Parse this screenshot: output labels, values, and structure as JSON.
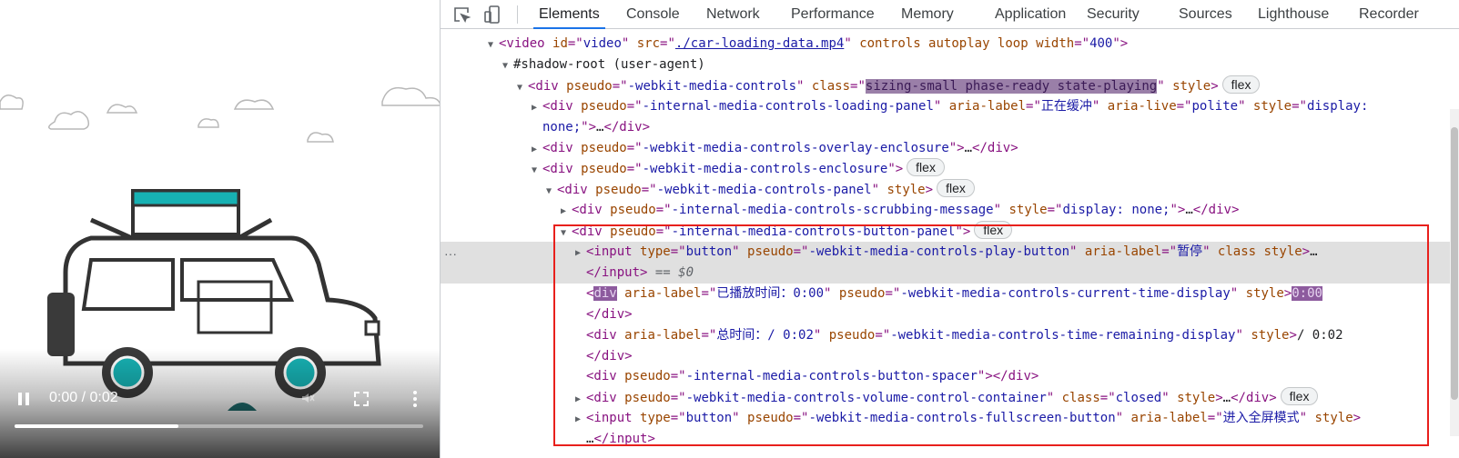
{
  "video": {
    "time_display": "0:00 / 0:02",
    "progress_fraction": 0.4,
    "icons": {
      "pause": "pause-icon",
      "mute": "mute-icon",
      "fullscreen": "fullscreen-icon",
      "menu": "more-vert-icon"
    }
  },
  "devtools": {
    "tabs": [
      "Elements",
      "Console",
      "Network",
      "Performance",
      "Memory",
      "Application",
      "Security",
      "Sources",
      "Lighthouse",
      "Recorder"
    ],
    "active_tab": "Elements",
    "tool_icons": [
      "inspect-element-icon",
      "device-toolbar-icon"
    ],
    "lines": [
      {
        "indent": 0,
        "arrow": "▼",
        "parts": [
          [
            "tag",
            "<video "
          ],
          [
            "an",
            "id"
          ],
          [
            "tag",
            "=\""
          ],
          [
            "av",
            "video"
          ],
          [
            "tag",
            "\" "
          ],
          [
            "an",
            "src"
          ],
          [
            "tag",
            "=\""
          ],
          [
            "link",
            "./car-loading-data.mp4"
          ],
          [
            "tag",
            "\" "
          ],
          [
            "an",
            "controls autoplay loop width"
          ],
          [
            "tag",
            "=\""
          ],
          [
            "av",
            "400"
          ],
          [
            "tag",
            "\">"
          ]
        ]
      },
      {
        "indent": 1,
        "arrow": "▼",
        "parts": [
          [
            "txt",
            "#shadow-root (user-agent)"
          ]
        ]
      },
      {
        "indent": 2,
        "arrow": "▼",
        "parts": [
          [
            "tag",
            "<div "
          ],
          [
            "an",
            "pseudo"
          ],
          [
            "tag",
            "=\""
          ],
          [
            "av",
            "-webkit-media-controls"
          ],
          [
            "tag",
            "\" "
          ],
          [
            "an",
            "class"
          ],
          [
            "tag",
            "=\""
          ],
          [
            "hl",
            "sizing-small phase-ready state-playing"
          ],
          [
            "tag",
            "\" "
          ],
          [
            "an",
            "style"
          ],
          [
            "tag",
            ">"
          ]
        ],
        "badge": "flex"
      },
      {
        "indent": 3,
        "arrow": "▶",
        "parts": [
          [
            "tag",
            "<div "
          ],
          [
            "an",
            "pseudo"
          ],
          [
            "tag",
            "=\""
          ],
          [
            "av",
            "-internal-media-controls-loading-panel"
          ],
          [
            "tag",
            "\" "
          ],
          [
            "an",
            "aria-label"
          ],
          [
            "tag",
            "=\""
          ],
          [
            "av",
            "正在缓冲"
          ],
          [
            "tag",
            "\" "
          ],
          [
            "an",
            "aria-live"
          ],
          [
            "tag",
            "=\""
          ],
          [
            "av",
            "polite"
          ],
          [
            "tag",
            "\" "
          ],
          [
            "an",
            "style"
          ],
          [
            "tag",
            "=\""
          ],
          [
            "av",
            "display:"
          ]
        ]
      },
      {
        "indent": 3,
        "arrow": "",
        "parts": [
          [
            "av",
            "none;"
          ],
          [
            "tag",
            "\">"
          ],
          [
            "txt",
            "…"
          ],
          [
            "tag",
            "</div>"
          ]
        ]
      },
      {
        "indent": 3,
        "arrow": "▶",
        "parts": [
          [
            "tag",
            "<div "
          ],
          [
            "an",
            "pseudo"
          ],
          [
            "tag",
            "=\""
          ],
          [
            "av",
            "-webkit-media-controls-overlay-enclosure"
          ],
          [
            "tag",
            "\">"
          ],
          [
            "txt",
            "…"
          ],
          [
            "tag",
            "</div>"
          ]
        ]
      },
      {
        "indent": 3,
        "arrow": "▼",
        "parts": [
          [
            "tag",
            "<div "
          ],
          [
            "an",
            "pseudo"
          ],
          [
            "tag",
            "=\""
          ],
          [
            "av",
            "-webkit-media-controls-enclosure"
          ],
          [
            "tag",
            "\">"
          ]
        ],
        "badge": "flex"
      },
      {
        "indent": 4,
        "arrow": "▼",
        "parts": [
          [
            "tag",
            "<div "
          ],
          [
            "an",
            "pseudo"
          ],
          [
            "tag",
            "=\""
          ],
          [
            "av",
            "-webkit-media-controls-panel"
          ],
          [
            "tag",
            "\" "
          ],
          [
            "an",
            "style"
          ],
          [
            "tag",
            ">"
          ]
        ],
        "badge": "flex"
      },
      {
        "indent": 5,
        "arrow": "▶",
        "parts": [
          [
            "tag",
            "<div "
          ],
          [
            "an",
            "pseudo"
          ],
          [
            "tag",
            "=\""
          ],
          [
            "av",
            "-internal-media-controls-scrubbing-message"
          ],
          [
            "tag",
            "\" "
          ],
          [
            "an",
            "style"
          ],
          [
            "tag",
            "=\""
          ],
          [
            "av",
            "display: none;"
          ],
          [
            "tag",
            "\">"
          ],
          [
            "txt",
            "…"
          ],
          [
            "tag",
            "</div>"
          ]
        ]
      },
      {
        "indent": 5,
        "arrow": "▼",
        "parts": [
          [
            "tag",
            "<div "
          ],
          [
            "an",
            "pseudo"
          ],
          [
            "tag",
            "=\""
          ],
          [
            "av",
            "-internal-media-controls-button-panel"
          ],
          [
            "tag",
            "\">"
          ]
        ],
        "badge": "flex"
      },
      {
        "indent": 6,
        "arrow": "▶",
        "sel": true,
        "parts": [
          [
            "tag",
            "<input "
          ],
          [
            "an",
            "type"
          ],
          [
            "tag",
            "=\""
          ],
          [
            "av",
            "button"
          ],
          [
            "tag",
            "\" "
          ],
          [
            "an",
            "pseudo"
          ],
          [
            "tag",
            "=\""
          ],
          [
            "av",
            "-webkit-media-controls-play-button"
          ],
          [
            "tag",
            "\" "
          ],
          [
            "an",
            "aria-label"
          ],
          [
            "tag",
            "=\""
          ],
          [
            "av",
            "暂停"
          ],
          [
            "tag",
            "\" "
          ],
          [
            "an",
            "class style"
          ],
          [
            "tag",
            ">"
          ],
          [
            "txt",
            "…"
          ]
        ]
      },
      {
        "indent": 6,
        "arrow": "",
        "sel": true,
        "parts": [
          [
            "tag",
            "</input>"
          ],
          [
            "dim",
            " == $0"
          ]
        ]
      },
      {
        "indent": 6,
        "arrow": "",
        "parts": [
          [
            "tag",
            "<"
          ],
          [
            "hl2",
            "div"
          ],
          [
            "tag",
            " "
          ],
          [
            "an",
            "aria-label"
          ],
          [
            "tag",
            "=\""
          ],
          [
            "av",
            "已播放时间：0:00"
          ],
          [
            "tag",
            "\" "
          ],
          [
            "an",
            "pseudo"
          ],
          [
            "tag",
            "=\""
          ],
          [
            "av",
            "-webkit-media-controls-current-time-display"
          ],
          [
            "tag",
            "\" "
          ],
          [
            "an",
            "style"
          ],
          [
            "tag",
            ">"
          ],
          [
            "hl2",
            "0:00"
          ]
        ]
      },
      {
        "indent": 6,
        "arrow": "",
        "parts": [
          [
            "tag",
            "</div>"
          ]
        ]
      },
      {
        "indent": 6,
        "arrow": "",
        "parts": [
          [
            "tag",
            "<div "
          ],
          [
            "an",
            "aria-label"
          ],
          [
            "tag",
            "=\""
          ],
          [
            "av",
            "总时间：/ 0:02"
          ],
          [
            "tag",
            "\" "
          ],
          [
            "an",
            "pseudo"
          ],
          [
            "tag",
            "=\""
          ],
          [
            "av",
            "-webkit-media-controls-time-remaining-display"
          ],
          [
            "tag",
            "\" "
          ],
          [
            "an",
            "style"
          ],
          [
            "tag",
            ">"
          ],
          [
            "txt",
            "/ 0:02"
          ]
        ]
      },
      {
        "indent": 6,
        "arrow": "",
        "parts": [
          [
            "tag",
            "</div>"
          ]
        ]
      },
      {
        "indent": 6,
        "arrow": "",
        "parts": [
          [
            "tag",
            "<div "
          ],
          [
            "an",
            "pseudo"
          ],
          [
            "tag",
            "=\""
          ],
          [
            "av",
            "-internal-media-controls-button-spacer"
          ],
          [
            "tag",
            "\"></div>"
          ]
        ]
      },
      {
        "indent": 6,
        "arrow": "▶",
        "parts": [
          [
            "tag",
            "<div "
          ],
          [
            "an",
            "pseudo"
          ],
          [
            "tag",
            "=\""
          ],
          [
            "av",
            "-webkit-media-controls-volume-control-container"
          ],
          [
            "tag",
            "\" "
          ],
          [
            "an",
            "class"
          ],
          [
            "tag",
            "=\""
          ],
          [
            "av",
            "closed"
          ],
          [
            "tag",
            "\" "
          ],
          [
            "an",
            "style"
          ],
          [
            "tag",
            ">"
          ],
          [
            "txt",
            "…"
          ],
          [
            "tag",
            "</div>"
          ]
        ],
        "badge": "flex"
      },
      {
        "indent": 6,
        "arrow": "▶",
        "parts": [
          [
            "tag",
            "<input "
          ],
          [
            "an",
            "type"
          ],
          [
            "tag",
            "=\""
          ],
          [
            "av",
            "button"
          ],
          [
            "tag",
            "\" "
          ],
          [
            "an",
            "pseudo"
          ],
          [
            "tag",
            "=\""
          ],
          [
            "av",
            "-webkit-media-controls-fullscreen-button"
          ],
          [
            "tag",
            "\" "
          ],
          [
            "an",
            "aria-label"
          ],
          [
            "tag",
            "=\""
          ],
          [
            "av",
            "进入全屏模式"
          ],
          [
            "tag",
            "\" "
          ],
          [
            "an",
            "style"
          ],
          [
            "tag",
            ">"
          ]
        ]
      },
      {
        "indent": 6,
        "arrow": "",
        "parts": [
          [
            "txt",
            "…"
          ],
          [
            "tag",
            "</input>"
          ]
        ]
      }
    ],
    "ellipsis_marker": "···"
  }
}
